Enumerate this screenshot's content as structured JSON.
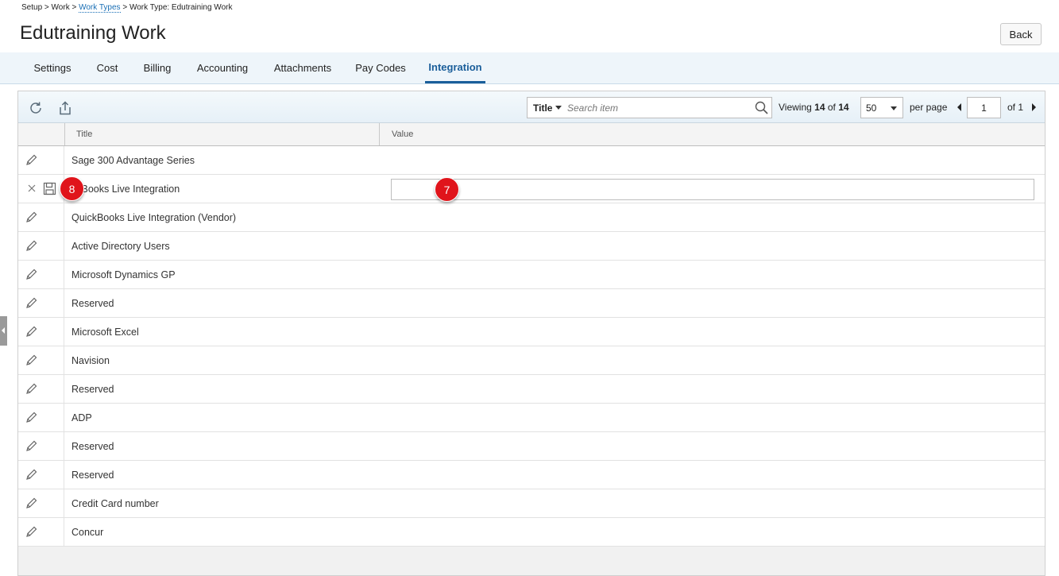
{
  "breadcrumb": {
    "setup": "Setup",
    "sep": ">",
    "work": "Work",
    "work_types": "Work Types",
    "current": "Work Type: Edutraining Work"
  },
  "page": {
    "title": "Edutraining Work",
    "back_label": "Back"
  },
  "tabs": [
    {
      "label": "Settings",
      "active": false
    },
    {
      "label": "Cost",
      "active": false
    },
    {
      "label": "Billing",
      "active": false
    },
    {
      "label": "Accounting",
      "active": false
    },
    {
      "label": "Attachments",
      "active": false
    },
    {
      "label": "Pay Codes",
      "active": false
    },
    {
      "label": "Integration",
      "active": true
    }
  ],
  "toolbar": {
    "refresh_icon": "refresh-icon",
    "export_icon": "export-icon",
    "search_field": "Title",
    "search_placeholder": "Search item",
    "viewing_label": "Viewing",
    "viewing_count": "14",
    "of_label": "of",
    "viewing_total": "14",
    "page_size": "50",
    "per_page_label": "per page",
    "page_number": "1",
    "of_pages_label": "of 1"
  },
  "grid": {
    "columns": [
      "Title",
      "Value"
    ],
    "rows": [
      {
        "title": "Sage 300 Advantage Series",
        "editing": false
      },
      {
        "title": "QuickBooks Live Integration",
        "display_title": "ckBooks Live Integration",
        "editing": true,
        "value": ""
      },
      {
        "title": "QuickBooks Live Integration (Vendor)",
        "editing": false
      },
      {
        "title": "Active Directory Users",
        "editing": false
      },
      {
        "title": "Microsoft Dynamics GP",
        "editing": false
      },
      {
        "title": "Reserved",
        "editing": false
      },
      {
        "title": "Microsoft Excel",
        "editing": false
      },
      {
        "title": "Navision",
        "editing": false
      },
      {
        "title": "Reserved",
        "editing": false
      },
      {
        "title": "ADP",
        "editing": false
      },
      {
        "title": "Reserved",
        "editing": false
      },
      {
        "title": "Reserved",
        "editing": false
      },
      {
        "title": "Credit Card number",
        "editing": false
      },
      {
        "title": "Concur",
        "editing": false
      }
    ]
  },
  "markers": {
    "save_marker": "8",
    "value_marker": "7"
  },
  "colors": {
    "accent": "#1a5e9a",
    "marker": "#e0141b",
    "link": "#1a6fb5"
  }
}
